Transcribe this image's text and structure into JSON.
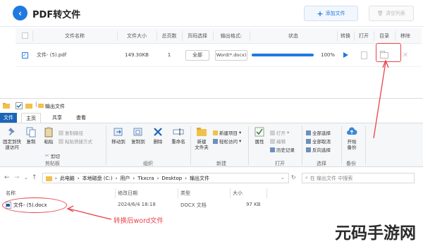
{
  "app": {
    "title": "PDF转文件",
    "add_files_label": "添加文件",
    "clear_list_label": "清空列表",
    "accent_color": "#1f7ae0"
  },
  "table": {
    "columns": [
      "文件名称",
      "文件大小",
      "总页数",
      "页码选择",
      "输出格式:",
      "状态",
      "转换",
      "打开",
      "目录",
      "移除"
    ],
    "rows": [
      {
        "checked": true,
        "name": "文件- (5).pdf",
        "size": "149.30KB",
        "pages": "1",
        "page_select": "全部",
        "output_format": "Word(*.docx)",
        "progress_percent": 100,
        "progress_label": "100%"
      }
    ]
  },
  "explorer": {
    "title": "输出文件",
    "tabs": [
      "文件",
      "主页",
      "共享",
      "查看"
    ],
    "ribbon": {
      "clipboard": {
        "pin_label_1": "固定到快",
        "pin_label_2": "速访问",
        "copy": "复制",
        "paste": "粘贴",
        "copy_path": "复制路径",
        "paste_shortcut": "粘贴快捷方式",
        "cut": "剪切",
        "group": "剪贴板"
      },
      "organize": {
        "move_to": "移动到",
        "copy_to": "复制到",
        "delete": "删除",
        "rename": "重命名",
        "group": "组织"
      },
      "new": {
        "new_folder_1": "新建",
        "new_folder_2": "文件夹",
        "new_item": "新建项目",
        "easy_access": "轻松访问",
        "group": "新建"
      },
      "open": {
        "properties": "属性",
        "open": "打开",
        "edit": "编辑",
        "history": "历史记录",
        "group": "打开"
      },
      "select": {
        "select_all": "全部选择",
        "select_none": "全部取消",
        "invert": "反向选择",
        "group": "选择"
      },
      "backup": {
        "label_1": "开始",
        "label_2": "备份",
        "group": "备份"
      }
    },
    "address": [
      "此电脑",
      "本地磁盘 (C:)",
      "用户",
      "Tkxcra",
      "Desktop",
      "输出文件"
    ],
    "search_placeholder": "在 输出文件 中搜索",
    "columns": [
      "名称",
      "修改日期",
      "类型",
      "大小"
    ],
    "files": [
      {
        "name": "文件- (5).docx",
        "modified": "2024/6/4 18:18",
        "type": "DOCX 文档",
        "size": "97 KB"
      }
    ]
  },
  "annotation": {
    "converted_label": "转换后word文件",
    "color": "#e8434a"
  },
  "watermark": "元码手游网"
}
